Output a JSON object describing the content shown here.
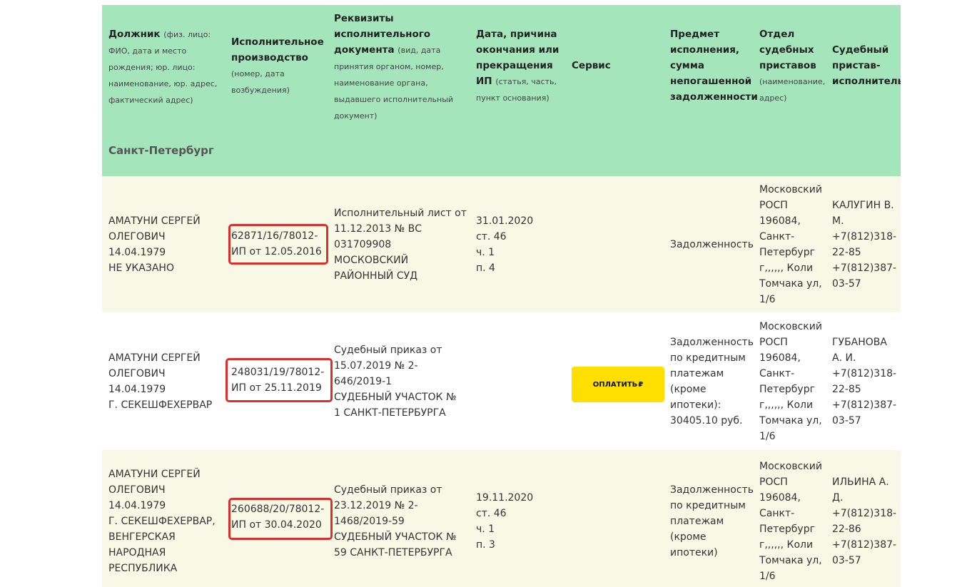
{
  "header": {
    "debtor": {
      "title": "Должник",
      "sub": "(физ. лицо: ФИО, дата и место рождения; юр. лицо: наименование, юр. адрес, фактический адрес)"
    },
    "proceeding": {
      "title": "Исполнительное производство",
      "sub": "(номер, дата возбуждения)"
    },
    "document": {
      "title": "Реквизиты исполнительного документа",
      "sub": "(вид, дата принятия органом, номер, наименование органа, выдавшего исполнительный документ)"
    },
    "end": {
      "title": "Дата, причина окончания или прекращения ИП",
      "sub": "(статья, часть, пункт основания)"
    },
    "service": {
      "title": "Сервис"
    },
    "subject": {
      "title": "Предмет исполнения, сумма непогашенной задолженности"
    },
    "department": {
      "title": "Отдел судебных приставов",
      "sub": "(наименование, адрес)"
    },
    "bailiff": {
      "title": "Судебный пристав-исполнитель"
    }
  },
  "region": "Санкт-Петербург",
  "rows": [
    {
      "debtor": "АМАТУНИ СЕРГЕЙ\nОЛЕГОВИЧ\n14.04.1979\nНЕ УКАЗАНО",
      "proceeding": "62871/16/78012-\nИП от 12.05.2016",
      "document": "Исполнительный лист от\n11.12.2013 № ВС\n031709908\nМОСКОВСКИЙ\nРАЙОННЫЙ СУД",
      "end": "31.01.2020\nст. 46\nч. 1\nп. 4",
      "subject": "Задолженность",
      "department": "Московский\nРОСП\n196084,\nСанкт-\nПетербург\nг,,,,,, Коли\nТомчака ул,\n1/6",
      "bailiff": "КАЛУГИН В.\nМ.\n+7(812)318-\n22-85\n+7(812)387-\n03-57"
    },
    {
      "debtor": "АМАТУНИ СЕРГЕЙ\nОЛЕГОВИЧ\n14.04.1979\nГ. СЕКЕШФЕХЕРВАР",
      "proceeding": "248031/19/78012-\nИП от 25.11.2019",
      "document": "Судебный приказ от\n15.07.2019 № 2-\n646/2019-1\nСУДЕБНЫЙ УЧАСТОК №\n1 САНКТ-ПЕТЕРБУРГА",
      "end": "",
      "pay_label": "ОПЛАТИТЬ",
      "pay_icon": "₽",
      "subject": "Задолженность\nпо кредитным\nплатежам\n(кроме\nипотеки):\n30405.10 руб.",
      "department": "Московский\nРОСП\n196084,\nСанкт-\nПетербург\nг,,,,,, Коли\nТомчака ул,\n1/6",
      "bailiff": "ГУБАНОВА\nА. И.\n+7(812)318-\n22-85\n+7(812)387-\n03-57"
    },
    {
      "debtor": "АМАТУНИ СЕРГЕЙ\nОЛЕГОВИЧ\n14.04.1979\nГ. СЕКЕШФЕХЕРВАР,\nВЕНГЕРСКАЯ\nНАРОДНАЯ\nРЕСПУБЛИКА",
      "proceeding": "260688/20/78012-\nИП от 30.04.2020",
      "document": "Судебный приказ от\n23.12.2019 № 2-\n1468/2019-59\nСУДЕБНЫЙ УЧАСТОК №\n59 САНКТ-ПЕТЕРБУРГА",
      "end": "19.11.2020\nст. 46\nч. 1\nп. 3",
      "subject": "Задолженность\nпо кредитным\nплатежам\n(кроме\nипотеки)",
      "department": "Московский\nРОСП\n196084,\nСанкт-\nПетербург\nг,,,,,, Коли\nТомчака ул,\n1/6",
      "bailiff": "ИЛЬИНА А.\nД.\n+7(812)318-\n22-86\n+7(812)387-\n03-57"
    }
  ],
  "colors": {
    "header_bg": "#a5e5bc",
    "row_bg_alt": "#f8f8e6",
    "highlight": "#d9302c",
    "pay_button": "#ffdf00"
  }
}
